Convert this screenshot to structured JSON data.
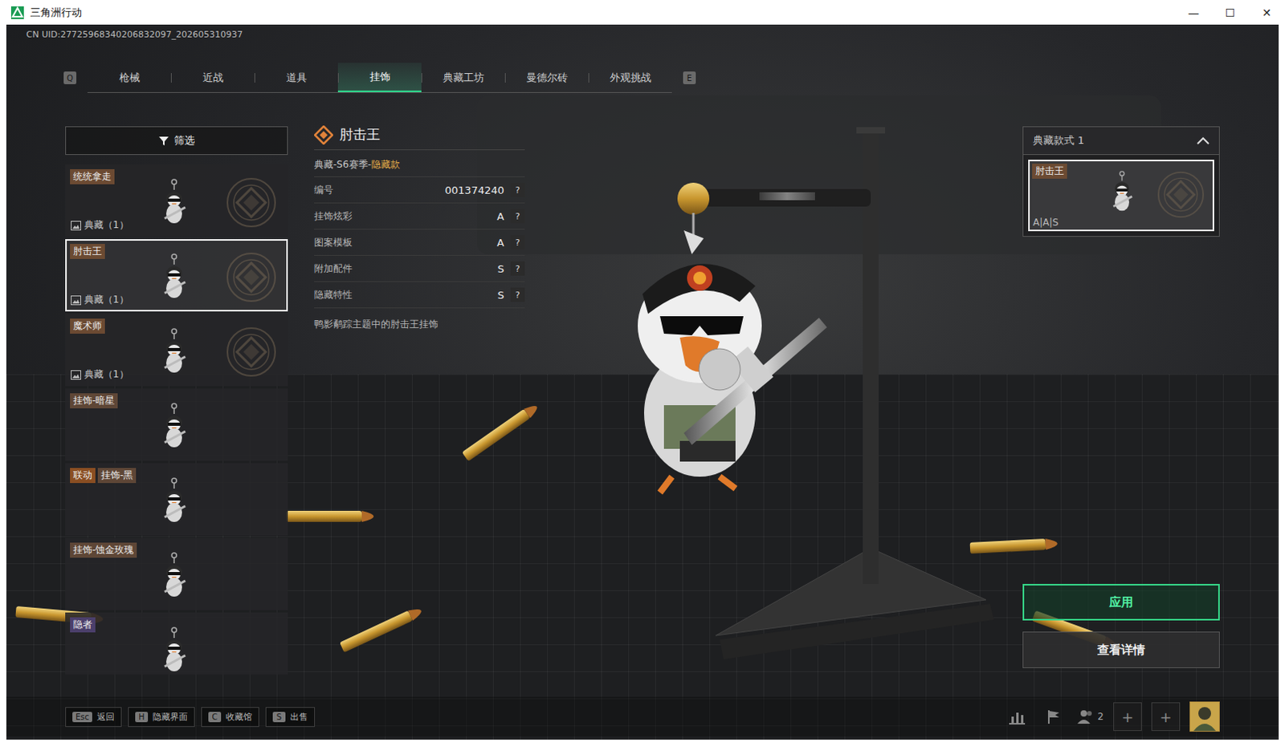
{
  "window": {
    "title": "三角洲行动",
    "controls": [
      "—",
      "☐",
      "✕"
    ]
  },
  "uid": "CN UID:27725968340206832097_202605310937",
  "tabs": {
    "prev_key": "Q",
    "next_key": "E",
    "items": [
      {
        "label": "枪械",
        "selected": false
      },
      {
        "label": "近战",
        "selected": false
      },
      {
        "label": "道具",
        "selected": false
      },
      {
        "label": "挂饰",
        "selected": true
      },
      {
        "label": "典藏工坊",
        "selected": false
      },
      {
        "label": "曼德尔砖",
        "selected": false
      },
      {
        "label": "外观挑战",
        "selected": false
      }
    ]
  },
  "filter": {
    "label": "筛选"
  },
  "sidebar": {
    "items": [
      {
        "name": "统统拿走",
        "badge": "典藏（1）",
        "selected": false,
        "color": "#6b4a32"
      },
      {
        "name": "肘击王",
        "badge": "典藏（1）",
        "selected": true,
        "color": "#6b4a32"
      },
      {
        "name": "魔术师",
        "badge": "典藏（1）",
        "selected": false,
        "color": "#6b4a32"
      },
      {
        "name": "挂饰-暗星",
        "selected": false,
        "color": "#5e4636"
      },
      {
        "name": "挂饰-黑",
        "tag": "联动",
        "selected": false,
        "color": "#5e4636"
      },
      {
        "name": "挂饰-蚀金玫瑰",
        "selected": false,
        "color": "#5e4636"
      },
      {
        "name": "隐者",
        "selected": false,
        "color": "#4b3f6b"
      }
    ]
  },
  "detail": {
    "title": "肘击王",
    "series": "典藏-S6赛季-",
    "rarity": "隐藏款",
    "attributes": [
      {
        "label": "编号",
        "value": "001374240",
        "help": "?"
      },
      {
        "label": "挂饰炫彩",
        "value": "A",
        "help": "?"
      },
      {
        "label": "图案模板",
        "value": "A",
        "help": "?"
      },
      {
        "label": "附加配件",
        "value": "S",
        "help": "?"
      },
      {
        "label": "隐藏特性",
        "value": "S",
        "help": "?"
      }
    ],
    "description": "鸭影鹬踪主题中的肘击王挂饰"
  },
  "style_select": {
    "label": "典藏款式 1",
    "expanded": true,
    "card": {
      "name": "肘击王",
      "grades": "A|A|S",
      "selected": true
    }
  },
  "actions": [
    {
      "label": "应用",
      "kind": "primary"
    },
    {
      "label": "查看详情",
      "kind": "secondary"
    }
  ],
  "bottom_bar": {
    "keys": [
      {
        "key": "Esc",
        "label": "返回"
      },
      {
        "key": "H",
        "label": "隐藏界面"
      },
      {
        "key": "C",
        "label": "收藏馆"
      },
      {
        "key": "S",
        "label": "出售"
      }
    ],
    "squad_count": "2",
    "slots": [
      "+",
      "+"
    ]
  }
}
